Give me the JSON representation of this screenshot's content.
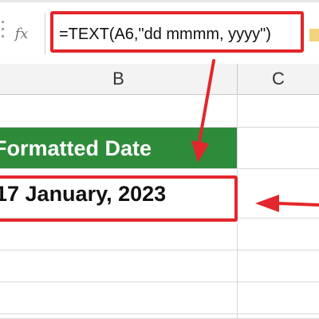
{
  "formula_bar": {
    "fx_icon": "fx-icon",
    "formula": "=TEXT(A6,\"dd mmmm, yyyy\")"
  },
  "columns": [
    {
      "label": "B"
    },
    {
      "label": "C"
    }
  ],
  "cells": {
    "header": "Formatted Date",
    "date_value": "17 January, 2023"
  },
  "colors": {
    "accent_red": "#e3262b",
    "header_green": "#2e8b3a"
  }
}
